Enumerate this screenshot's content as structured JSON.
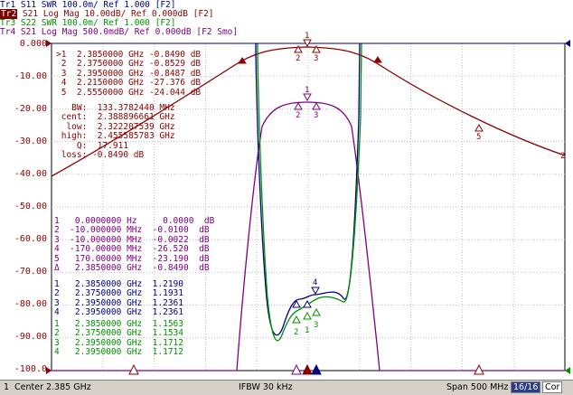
{
  "traces": [
    {
      "id": "Tr1",
      "text": "S11 SWR 100.0m/ Ref 1.000 [F2]",
      "color": "#000080",
      "active": false
    },
    {
      "id": "Tr2",
      "text": "S21 Log Mag 10.00dB/ Ref 0.000dB [F2]",
      "color": "#8b0000",
      "active": true
    },
    {
      "id": "Tr3",
      "text": "S22 SWR 100.0m/ Ref 1.000 [F2]",
      "color": "#009000",
      "active": false
    },
    {
      "id": "Tr4",
      "text": "S21 Log Mag 500.0mdB/ Ref 0.000dB [F2 Smo]",
      "color": "#800080",
      "active": false
    }
  ],
  "y_axis": [
    "0.000",
    "-10.00",
    "-20.00",
    "-30.00",
    "-40.00",
    "-50.00",
    "-60.00",
    "-70.00",
    "-80.00",
    "-90.00",
    "-100.0"
  ],
  "marker_tables": {
    "tr2": {
      "color": "#8b0000",
      "lines": [
        ">1  2.3850000 GHz -0.8490 dB",
        " 2  2.3750000 GHz -0.8529 dB",
        " 3  2.3950000 GHz -0.8487 dB",
        " 4  2.2150000 GHz -27.376 dB",
        " 5  2.5550000 GHz -24.044 dB"
      ]
    },
    "bw": {
      "color": "#8b0000",
      "lines": [
        "   BW:  133.3782440 MHz",
        " cent:  2.388896661 GHz",
        "  low:  2.322207539 GHz",
        " high:  2.455585783 GHz",
        "    Q:  17.911",
        " loss: -0.8490 dB"
      ]
    },
    "tr4": {
      "color": "#800080",
      "lines": [
        "1   0.0000000 Hz     0.0000  dB",
        "2  -10.000000 MHz  -0.0100  dB",
        "3  -10.000000 MHz  -0.0022  dB",
        "4  -170.00000 MHz  -26.520  dB",
        "5   170.00000 MHz  -23.190  dB",
        "Δ   2.3850000 GHz  -0.8490  dB"
      ]
    },
    "tr1": {
      "color": "#000080",
      "lines": [
        "1   2.3850000 GHz  1.2190",
        "2   2.3750000 GHz  1.1931",
        "3   2.3950000 GHz  1.2361",
        "4   2.3950000 GHz  1.2361"
      ]
    },
    "tr3": {
      "color": "#009000",
      "lines": [
        "1   2.3850000 GHz  1.1563",
        "2   2.3750000 GHz  1.1534",
        "3   2.3950000 GHz  1.1712",
        "4   2.3950000 GHz  1.1712"
      ]
    }
  },
  "status": {
    "channel": "1",
    "center": "Center 2.385 GHz",
    "ifbw": "IFBW 30 kHz",
    "span": "Span 500 MHz",
    "points": "16/16",
    "cor": "Cor"
  },
  "colors": {
    "tr1": "#000080",
    "tr2": "#8b0000",
    "tr3": "#009000",
    "tr4": "#800080",
    "grid": "#c0c0c0"
  }
}
